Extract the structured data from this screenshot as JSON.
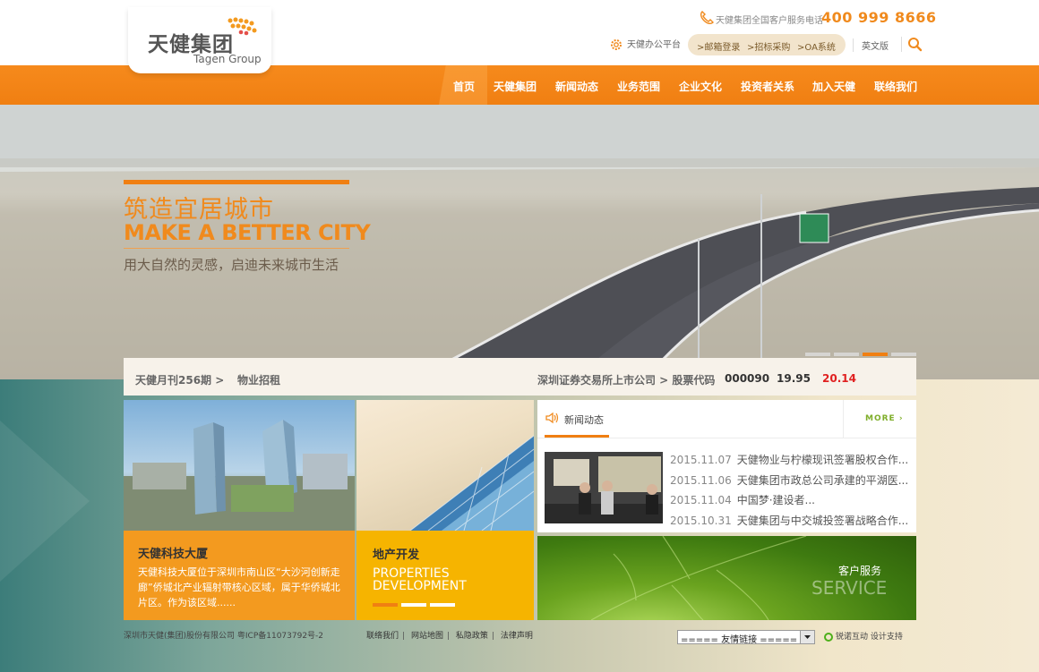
{
  "brand": {
    "name_cn": "天健集团",
    "name_en": "Tagen Group"
  },
  "topbar": {
    "hotline_label": "天健集团全国客户服务电话",
    "hotline_number": "400 999 8666",
    "office_platform": "天健办公平台",
    "quick_links": [
      ">邮箱登录",
      ">招标采购",
      ">OA系统"
    ],
    "language": "英文版"
  },
  "nav": {
    "items": [
      "首页",
      "天健集团",
      "新闻动态",
      "业务范围",
      "企业文化",
      "投资者关系",
      "加入天健",
      "联络我们"
    ]
  },
  "banner": {
    "slogan_cn": "筑造宜居城市",
    "slogan_en": "MAKE A BETTER CITY",
    "subtitle": "用大自然的灵感，启迪未来城市生活",
    "slide_count": 4,
    "active_slide": 3
  },
  "info_bar": {
    "magazine": "天健月刊256期 >",
    "recruit": "物业招租",
    "listing": "深圳证券交易所上市公司 > 股票代码",
    "stock_code": "000090",
    "price_1": "19.95",
    "price_2": "20.14"
  },
  "tiles": {
    "tech_building": {
      "title": "天健科技大厦",
      "body": "天健科技大厦位于深圳市南山区“大沙河创新走廊”侨城北产业辐射带核心区域，属于华侨城北片区。作为该区域......"
    },
    "real_estate": {
      "title": "地产开发",
      "en_line1": "PROPERTIES",
      "en_line2": "DEVELOPMENT"
    }
  },
  "news": {
    "title": "新闻动态",
    "more": "MORE ›",
    "items": [
      {
        "date": "2015.11.07",
        "text": "天健物业与柠檬现讯签署股权合作..."
      },
      {
        "date": "2015.11.06",
        "text": "天健集团市政总公司承建的平湖医..."
      },
      {
        "date": "2015.11.04",
        "text": "中国梦·建设者..."
      },
      {
        "date": "2015.10.31",
        "text": "天健集团与中交城投签署战略合作..."
      }
    ]
  },
  "service": {
    "title_cn": "客户服务",
    "title_en": "SERVICE"
  },
  "footer": {
    "copyright": "深圳市天健(集团)股份有限公司  粤ICP备11073792号-2",
    "links": [
      "联络我们",
      "网站地图",
      "私隐政策",
      "法律声明"
    ],
    "friend_links": "===== 友情链接 =====",
    "credit": "锐诺互动 设计支持"
  },
  "colors": {
    "brand_orange": "#f08a1d",
    "tile_orange": "#f39a1f",
    "tile_yellow": "#f6b400",
    "price_red": "#e02020",
    "more_green": "#7fae2a"
  }
}
